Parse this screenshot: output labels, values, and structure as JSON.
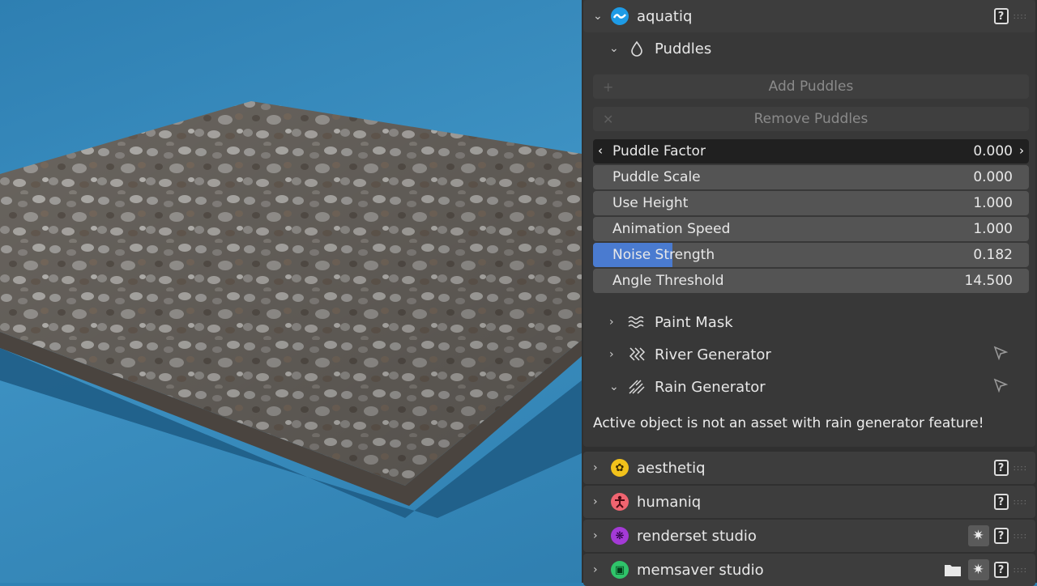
{
  "panels": {
    "aquatiq": {
      "name": "aquatiq",
      "puddles": {
        "title": "Puddles",
        "add_label": "Add Puddles",
        "remove_label": "Remove Puddles",
        "fields": [
          {
            "label": "Puddle Factor",
            "value": "0.000"
          },
          {
            "label": "Puddle Scale",
            "value": "0.000"
          },
          {
            "label": "Use Height",
            "value": "1.000"
          },
          {
            "label": "Animation Speed",
            "value": "1.000"
          },
          {
            "label": "Noise Strength",
            "value": "0.182",
            "fill": 0.182
          },
          {
            "label": "Angle Threshold",
            "value": "14.500"
          }
        ]
      },
      "subpanels": [
        {
          "label": "Paint Mask"
        },
        {
          "label": "River Generator"
        },
        {
          "label": "Rain Generator"
        }
      ],
      "message": "Active object is not an asset with rain generator feature!"
    },
    "aesthetiq": {
      "name": "aesthetiq"
    },
    "humaniq": {
      "name": "humaniq"
    },
    "renderset": {
      "name": "renderset studio"
    },
    "memsaver": {
      "name": "memsaver studio"
    }
  },
  "colors": {
    "accent": "#4a7bd0",
    "aquatiq_logo": "#1e9be6",
    "aesthetiq_logo": "#f2c21b",
    "humaniq_logo": "#f06470",
    "renderset_logo": "#a43ad6",
    "memsaver_logo": "#2fc46a"
  },
  "icons": {
    "help": "?",
    "gear": "✷"
  }
}
